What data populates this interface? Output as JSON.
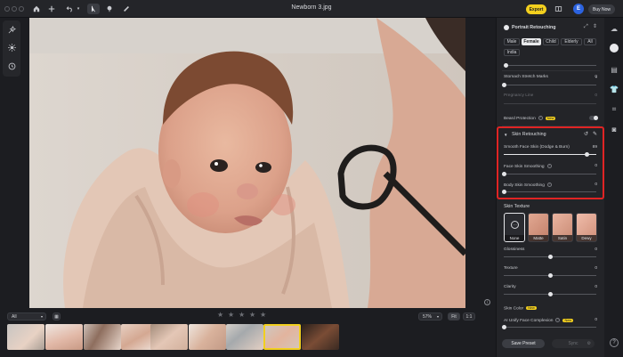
{
  "window": {
    "title": "Newborn 3.jpg"
  },
  "topbar": {
    "export_label": "Export",
    "avatar_letter": "E",
    "buy_now_label": "Buy Now"
  },
  "panel": {
    "title": "Portrait Retouching",
    "gender_options": [
      "Male",
      "Female",
      "Child",
      "Elderly",
      "All"
    ],
    "region_options": [
      "India"
    ],
    "active_option": "Female",
    "stomach_label": "Stomach Stretch Marks",
    "stomach_value": "0",
    "pregnancy_label": "Pregnancy Line",
    "pregnancy_value": "0",
    "beard_label": "Beard Protection",
    "new_tag": "New",
    "skin_retouching": {
      "title": "Skin Retouching",
      "face_label": "Smooth Face Skin  (Dodge & Burn)",
      "face_value": "89",
      "face_level": 0.89,
      "face_smoothing_label": "Face Skin Smoothing",
      "face_smoothing_value": "0",
      "body_smoothing_label": "Body Skin Smoothing",
      "body_smoothing_value": "0"
    },
    "skin_texture": {
      "title": "Skin Texture",
      "options": [
        "None",
        "Matte",
        "Satin",
        "Dewy"
      ],
      "glossiness_label": "Glossiness",
      "glossiness_value": "0",
      "texture_label": "Texture",
      "texture_value": "0",
      "clarity_label": "Clarity",
      "clarity_value": "0"
    },
    "skin_color": {
      "title": "Skin Color",
      "unify_label": "AI Unify Face Complexion",
      "unify_value": "0"
    },
    "save_preset_label": "Save Preset",
    "sync_label": "Sync"
  },
  "filmstrip": {
    "filter": "All",
    "zoom": "57%",
    "fit_label": "Fit",
    "one_to_one_label": "1:1",
    "rating_stars": 5,
    "thumbnails": 9,
    "selected_index": 7
  },
  "colors": {
    "accent": "#f2cf1e",
    "highlight": "#e02424",
    "avatar": "#2c63e0"
  }
}
